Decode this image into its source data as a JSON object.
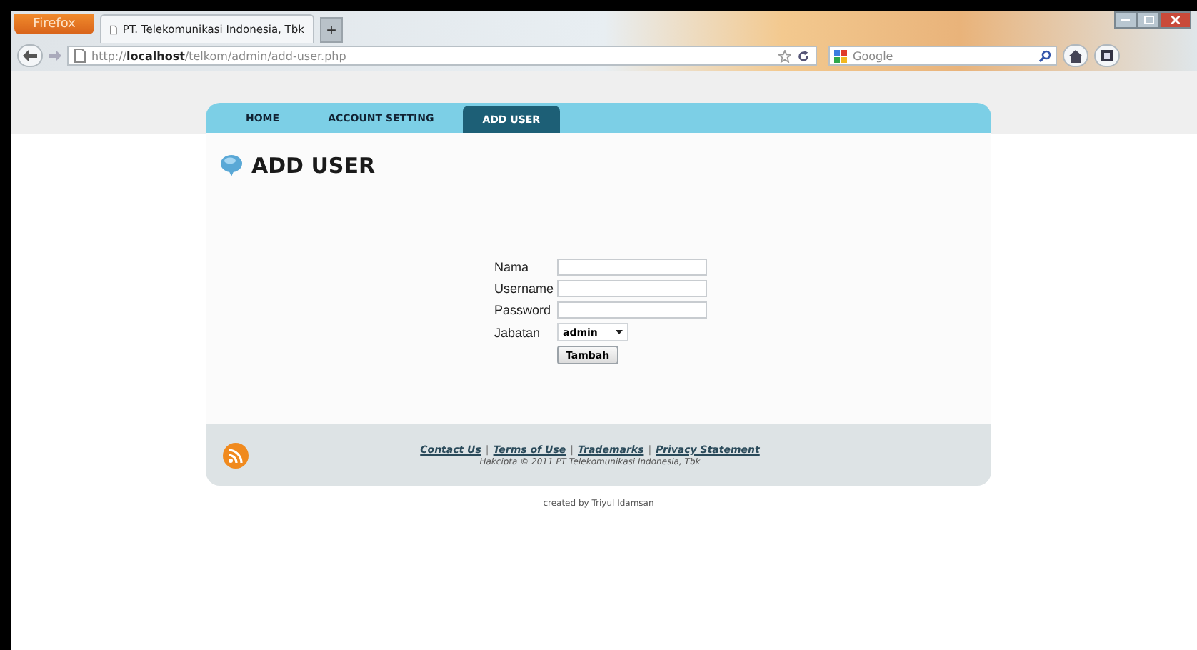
{
  "browser": {
    "menu_button": "Firefox",
    "tab_title": "PT. Telekomunikasi Indonesia, Tbk",
    "new_tab": "+",
    "url": "http://**localhost**/telkom/admin/add-user.php",
    "search": {
      "placeholder": "Google"
    }
  },
  "nav": [
    {
      "label": "HOME",
      "selected": false
    },
    {
      "label": "ACCOUNT SETTING",
      "selected": false
    },
    {
      "label": "ADD USER",
      "selected": true
    }
  ],
  "heading": "ADD USER",
  "form": {
    "fields": [
      {
        "label": "Nama",
        "kind": "text"
      },
      {
        "label": "Username",
        "kind": "text"
      },
      {
        "label": "Password",
        "kind": "password"
      },
      {
        "label": "Jabatan",
        "kind": "select",
        "value": "admin"
      }
    ],
    "submit": "Tambah"
  },
  "footer": {
    "links": [
      "Contact Us",
      "Terms of Use",
      "Trademarks",
      "Privacy Statement"
    ],
    "separator": "|",
    "copyright": "Hakcipta © 2011 PT Telekomunikasi Indonesia, Tbk"
  },
  "credit": "created by Triyul Idamsan"
}
